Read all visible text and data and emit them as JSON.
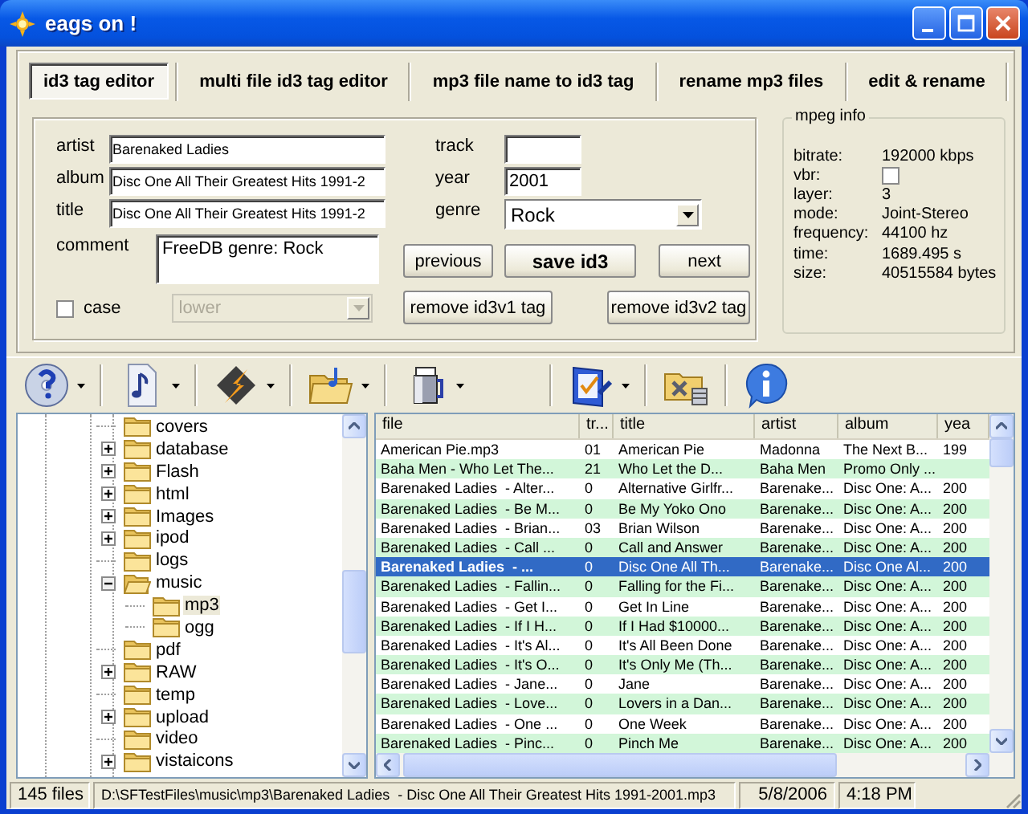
{
  "window": {
    "title": "eags on !"
  },
  "tabs": [
    {
      "label": "id3 tag editor",
      "selected": true
    },
    {
      "label": "multi file id3 tag editor",
      "selected": false
    },
    {
      "label": "mp3 file name to id3 tag",
      "selected": false
    },
    {
      "label": "rename mp3 files",
      "selected": false
    },
    {
      "label": "edit & rename",
      "selected": false
    }
  ],
  "tag_form": {
    "text_fields": [
      {
        "label": "artist",
        "value": "Barenaked Ladies"
      },
      {
        "label": "album",
        "value": "Disc One All Their Greatest Hits 1991-2"
      },
      {
        "label": "title",
        "value": "Disc One All Their Greatest Hits 1991-2"
      }
    ],
    "comment": {
      "label": "comment",
      "value": "FreeDB genre: Rock"
    },
    "case": {
      "label": "case",
      "checked": false
    },
    "case_select": {
      "value": "lower",
      "disabled": true
    },
    "track": {
      "label": "track"
    },
    "year": {
      "label": "year",
      "value": "2001"
    },
    "genre": {
      "label": "genre",
      "value": "Rock"
    },
    "buttons": [
      {
        "label": "previous",
        "kind": "normal"
      },
      {
        "label": "save id3",
        "kind": "default"
      },
      {
        "label": "next",
        "kind": "normal"
      },
      {
        "label": "remove id3v1 tag",
        "kind": "normal"
      },
      {
        "label": "remove id3v2 tag",
        "kind": "normal"
      }
    ]
  },
  "mpeg_info": {
    "title": "mpeg info",
    "rows": [
      {
        "label": "bitrate:",
        "kind": "text",
        "value": "192000 kbps"
      },
      {
        "label": "vbr:",
        "kind": "checkbox",
        "checked": false
      },
      {
        "label": "layer:",
        "kind": "text",
        "value": "3"
      },
      {
        "label": "mode:",
        "kind": "text",
        "value": "Joint-Stereo"
      },
      {
        "label": "frequency:",
        "kind": "text",
        "value": "44100 hz"
      },
      {
        "label": "time:",
        "kind": "text",
        "value": "1689.495 s"
      },
      {
        "label": "size:",
        "kind": "text",
        "value": "40515584 bytes"
      }
    ]
  },
  "tree": {
    "items": [
      {
        "label": "covers",
        "kind": "leaf",
        "expanded": false,
        "selected": false
      },
      {
        "label": "database",
        "kind": "branch",
        "expanded": false,
        "selected": false
      },
      {
        "label": "Flash",
        "kind": "branch",
        "expanded": false,
        "selected": false
      },
      {
        "label": "html",
        "kind": "branch",
        "expanded": false,
        "selected": false
      },
      {
        "label": "Images",
        "kind": "branch",
        "expanded": false,
        "selected": false
      },
      {
        "label": "ipod",
        "kind": "branch",
        "expanded": false,
        "selected": false
      },
      {
        "label": "logs",
        "kind": "leaf",
        "expanded": false,
        "selected": false
      },
      {
        "label": "music",
        "kind": "branch",
        "expanded": true,
        "selected": false,
        "children": [
          {
            "label": "mp3",
            "kind": "leaf",
            "expanded": false,
            "selected": true
          },
          {
            "label": "ogg",
            "kind": "leaf",
            "expanded": false,
            "selected": false
          }
        ]
      },
      {
        "label": "pdf",
        "kind": "leaf",
        "expanded": false,
        "selected": false
      },
      {
        "label": "RAW",
        "kind": "branch",
        "expanded": false,
        "selected": false
      },
      {
        "label": "temp",
        "kind": "leaf",
        "expanded": false,
        "selected": false
      },
      {
        "label": "upload",
        "kind": "branch",
        "expanded": false,
        "selected": false
      },
      {
        "label": "video",
        "kind": "leaf",
        "expanded": false,
        "selected": false
      },
      {
        "label": "vistaicons",
        "kind": "branch",
        "expanded": false,
        "selected": false
      }
    ]
  },
  "table": {
    "columns": [
      "file",
      "tr...",
      "title",
      "artist",
      "album",
      "yea"
    ],
    "rows": [
      {
        "cells": [
          "American Pie.mp3",
          "01",
          "American Pie",
          "Madonna",
          "The Next B...",
          "199"
        ],
        "selected": false
      },
      {
        "cells": [
          "Baha Men - Who Let The...",
          "21",
          "Who Let the D...",
          "Baha Men",
          "Promo Only ...",
          ""
        ],
        "selected": false
      },
      {
        "cells": [
          "Barenaked Ladies  - Alter...",
          "0",
          "Alternative Girlfr...",
          "Barenake...",
          "Disc One: A...",
          "200"
        ],
        "selected": false
      },
      {
        "cells": [
          "Barenaked Ladies  - Be M...",
          "0",
          "Be My Yoko Ono",
          "Barenake...",
          "Disc One: A...",
          "200"
        ],
        "selected": false
      },
      {
        "cells": [
          "Barenaked Ladies  - Brian...",
          "03",
          "Brian Wilson",
          "Barenake...",
          "Disc One: A...",
          "200"
        ],
        "selected": false
      },
      {
        "cells": [
          "Barenaked Ladies  - Call ...",
          "0",
          "Call and Answer",
          "Barenake...",
          "Disc One: A...",
          "200"
        ],
        "selected": false
      },
      {
        "cells": [
          "Barenaked Ladies  - ...",
          "0",
          "Disc One All Th...",
          "Barenake...",
          "Disc One Al...",
          "200"
        ],
        "selected": true
      },
      {
        "cells": [
          "Barenaked Ladies  - Fallin...",
          "0",
          "Falling for the Fi...",
          "Barenake...",
          "Disc One: A...",
          "200"
        ],
        "selected": false
      },
      {
        "cells": [
          "Barenaked Ladies  - Get I...",
          "0",
          "Get In Line",
          "Barenake...",
          "Disc One: A...",
          "200"
        ],
        "selected": false
      },
      {
        "cells": [
          "Barenaked Ladies  - If I H...",
          "0",
          "If I Had $10000...",
          "Barenake...",
          "Disc One: A...",
          "200"
        ],
        "selected": false
      },
      {
        "cells": [
          "Barenaked Ladies  - It's Al...",
          "0",
          "It's All Been Done",
          "Barenake...",
          "Disc One: A...",
          "200"
        ],
        "selected": false
      },
      {
        "cells": [
          "Barenaked Ladies  - It's O...",
          "0",
          "It's Only Me (Th...",
          "Barenake...",
          "Disc One: A...",
          "200"
        ],
        "selected": false
      },
      {
        "cells": [
          "Barenaked Ladies  - Jane...",
          "0",
          "Jane",
          "Barenake...",
          "Disc One: A...",
          "200"
        ],
        "selected": false
      },
      {
        "cells": [
          "Barenaked Ladies  - Love...",
          "0",
          "Lovers in a Dan...",
          "Barenake...",
          "Disc One: A...",
          "200"
        ],
        "selected": false
      },
      {
        "cells": [
          "Barenaked Ladies  - One ...",
          "0",
          "One Week",
          "Barenake...",
          "Disc One: A...",
          "200"
        ],
        "selected": false
      },
      {
        "cells": [
          "Barenaked Ladies  - Pinc...",
          "0",
          "Pinch Me",
          "Barenake...",
          "Disc One: A...",
          "200"
        ],
        "selected": false
      }
    ]
  },
  "status_bar": {
    "count": "145 files",
    "path": "D:\\SFTestFiles\\music\\mp3\\Barenaked Ladies  - Disc One All Their Greatest Hits 1991-2001.mp3",
    "date": "5/8/2006",
    "time": "4:18 PM"
  }
}
